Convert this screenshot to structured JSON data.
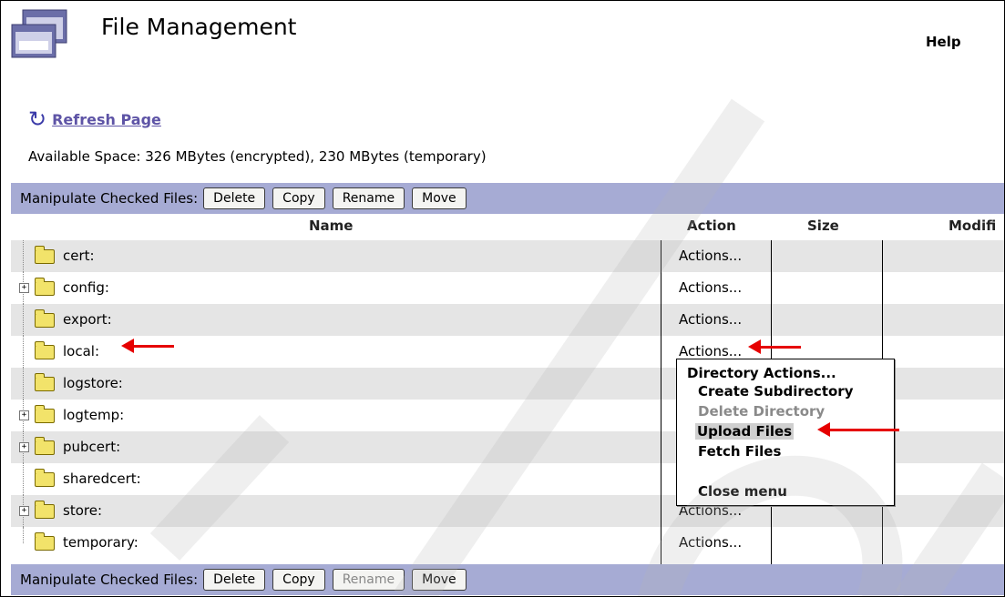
{
  "header": {
    "title": "File Management",
    "help": "Help"
  },
  "refresh": {
    "label": "Refresh Page"
  },
  "space": "Available Space: 326 MBytes (encrypted), 230 MBytes (temporary)",
  "toolbar": {
    "label": "Manipulate Checked Files:",
    "buttons": [
      "Delete",
      "Copy",
      "Rename",
      "Move"
    ]
  },
  "columns": [
    "Name",
    "Action",
    "Size",
    "Modifi"
  ],
  "rows": [
    {
      "name": "cert:",
      "action": "Actions..."
    },
    {
      "name": "config:",
      "action": "Actions..."
    },
    {
      "name": "export:",
      "action": "Actions..."
    },
    {
      "name": "local:",
      "action": "Actions..."
    },
    {
      "name": "logstore:",
      "action": ""
    },
    {
      "name": "logtemp:",
      "action": ""
    },
    {
      "name": "pubcert:",
      "action": ""
    },
    {
      "name": "sharedcert:",
      "action": ""
    },
    {
      "name": "store:",
      "action": "Actions..."
    },
    {
      "name": "temporary:",
      "action": "Actions..."
    }
  ],
  "menu": {
    "title": "Directory Actions...",
    "items": [
      "Create Subdirectory",
      "Delete Directory",
      "Upload Files",
      "Fetch Files",
      "Close menu"
    ]
  }
}
